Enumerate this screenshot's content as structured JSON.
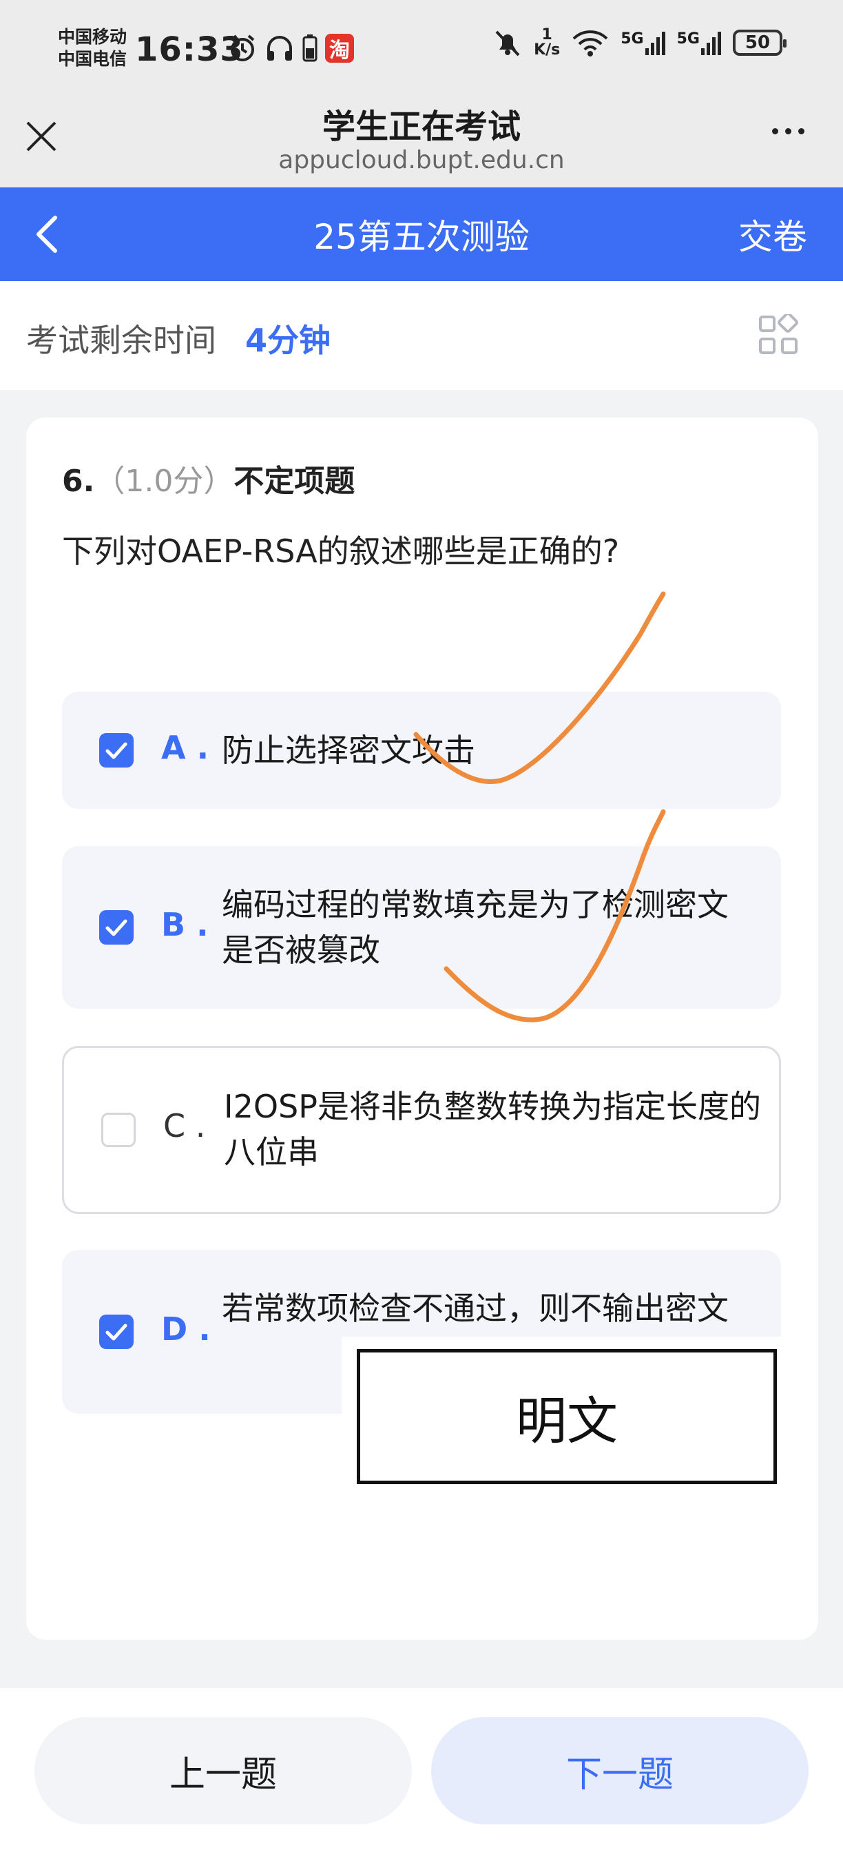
{
  "status_bar": {
    "carrier1": "中国移动",
    "carrier2": "中国电信",
    "time": "16:33",
    "app_badge": "淘",
    "net_speed_value": "1",
    "net_speed_unit": "K/s",
    "signal1": "5G",
    "signal2": "5G",
    "battery": "50",
    "icons": [
      "alarm-icon",
      "headphones-icon",
      "battery-small-icon",
      "taobao-icon",
      "mute-icon",
      "wifi-icon",
      "signal-icon",
      "signal-icon",
      "battery-icon"
    ]
  },
  "browser": {
    "title": "学生正在考试",
    "url": "appucloud.bupt.edu.cn"
  },
  "app_bar": {
    "title": "25第五次测验",
    "submit_label": "交卷",
    "accent": "#3b6ef5"
  },
  "timer": {
    "label": "考试剩余时间",
    "value": "4分钟"
  },
  "question": {
    "number": "6.",
    "score": "（1.0分）",
    "type": "不定项题",
    "text": "下列对OAEP-RSA的叙述哪些是正确的?",
    "options": [
      {
        "letter": "A .",
        "text": "防止选择密文攻击",
        "checked": true
      },
      {
        "letter": "B .",
        "text": "编码过程的常数填充是为了检测密文是否被篡改",
        "checked": true
      },
      {
        "letter": "C .",
        "text": "I2OSP是将非负整数转换为指定长度的八位串",
        "checked": false
      },
      {
        "letter": "D .",
        "text": "若常数项检查不通过，则不输出密文",
        "checked": true
      }
    ]
  },
  "annotation": {
    "box_text": "明文",
    "ink_color": "#ee8b3d"
  },
  "footer": {
    "prev_label": "上一题",
    "next_label": "下一题"
  }
}
